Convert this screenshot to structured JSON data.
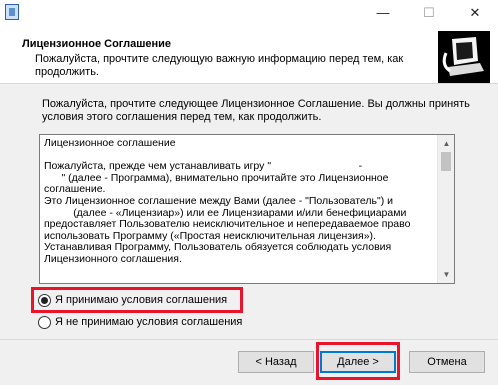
{
  "window": {
    "min_glyph": "—",
    "max_glyph": "☐",
    "close_glyph": "✕"
  },
  "header": {
    "title": "Лицензионное Соглашение",
    "subtitle": "Пожалуйста, прочтите следующую важную информацию перед тем, как продолжить."
  },
  "intro_text": "Пожалуйста, прочтите следующее Лицензионное Соглашение. Вы должны принять условия этого соглашения перед тем, как продолжить.",
  "license": {
    "text": "Лицензионное соглашение\n\nПожалуйста, прежде чем устанавливать игру \"                              -\n      \" (далее - Программа), внимательно прочитайте это Лицензионное\nсоглашение.\nЭто Лицензионное соглашение между Вами (далее - \"Пользователь\") и\n          (далее - «Лицензиар») или ее Лицензиарами и/или бенефициарами\nпредоставляет Пользователю неисключительное и непередаваемое право\nиспользовать Программу («Простая неисключительная лицензия»).\nУстанавливая Программу, Пользователь обязуется соблюдать условия\nЛицензионного соглашения."
  },
  "options": {
    "accept_label": "Я принимаю условия соглашения",
    "decline_label": "Я не принимаю условия соглашения",
    "selected": "accept"
  },
  "buttons": {
    "back": "< Назад",
    "next": "Далее >",
    "cancel": "Отмена"
  },
  "colors": {
    "highlight": "#e8142b",
    "default_button_border": "#0078d7"
  },
  "icons": {
    "scroll_up": "▲",
    "scroll_down": "▼"
  }
}
